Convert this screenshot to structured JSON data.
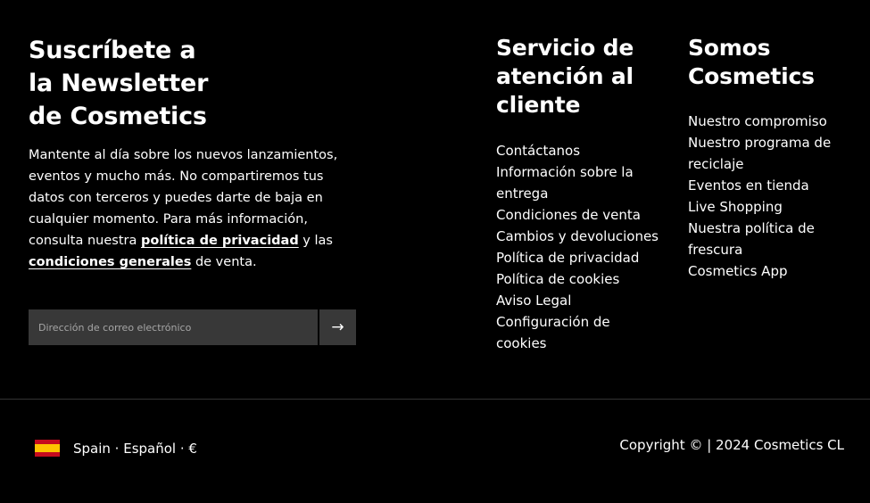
{
  "newsletter": {
    "title_lines": [
      "Suscríbete a",
      "la Newsletter",
      "de Cosmetics"
    ],
    "description_part1": "Mantente al día sobre los nuevos lanzamientos, eventos y mucho más. No compartiremos tus datos con terceros y puedes darte de baja en cualquier momento. Para más información, consulta nuestra ",
    "privacy_link": "política de privacidad",
    "description_part2": " y las ",
    "terms_link": "condiciones generales",
    "description_part3": " de venta.",
    "email_placeholder": "Dirección de correo electrónico",
    "submit_icon": "arrow-right-icon",
    "submit_glyph": "→"
  },
  "customer_service": {
    "title_lines": [
      "Servicio de",
      "atención al",
      "cliente"
    ],
    "links": [
      "Contáctanos",
      "Información sobre la entrega",
      "Condiciones de venta",
      "Cambios y devoluciones",
      "Política de privacidad",
      "Política de cookies",
      "Aviso Legal",
      "Configuración de cookies"
    ]
  },
  "about": {
    "title_lines": [
      "Somos",
      "Cosmetics"
    ],
    "links": [
      "Nuestro compromiso",
      "Nuestro programa de reciclaje",
      "Eventos en tienda",
      "Live Shopping",
      "Nuestra política de frescura",
      "Cosmetics App"
    ]
  },
  "footer": {
    "flag_icon": "spain-flag-icon",
    "locale": "Spain · Español · €",
    "copyright": "Copyright © | 2024 Cosmetics CL"
  },
  "colors": {
    "background": "#000000",
    "text": "#ffffff",
    "input_background": "#383838",
    "divider": "#333333",
    "flag_red": "#c60b1e",
    "flag_yellow": "#ffc400"
  }
}
